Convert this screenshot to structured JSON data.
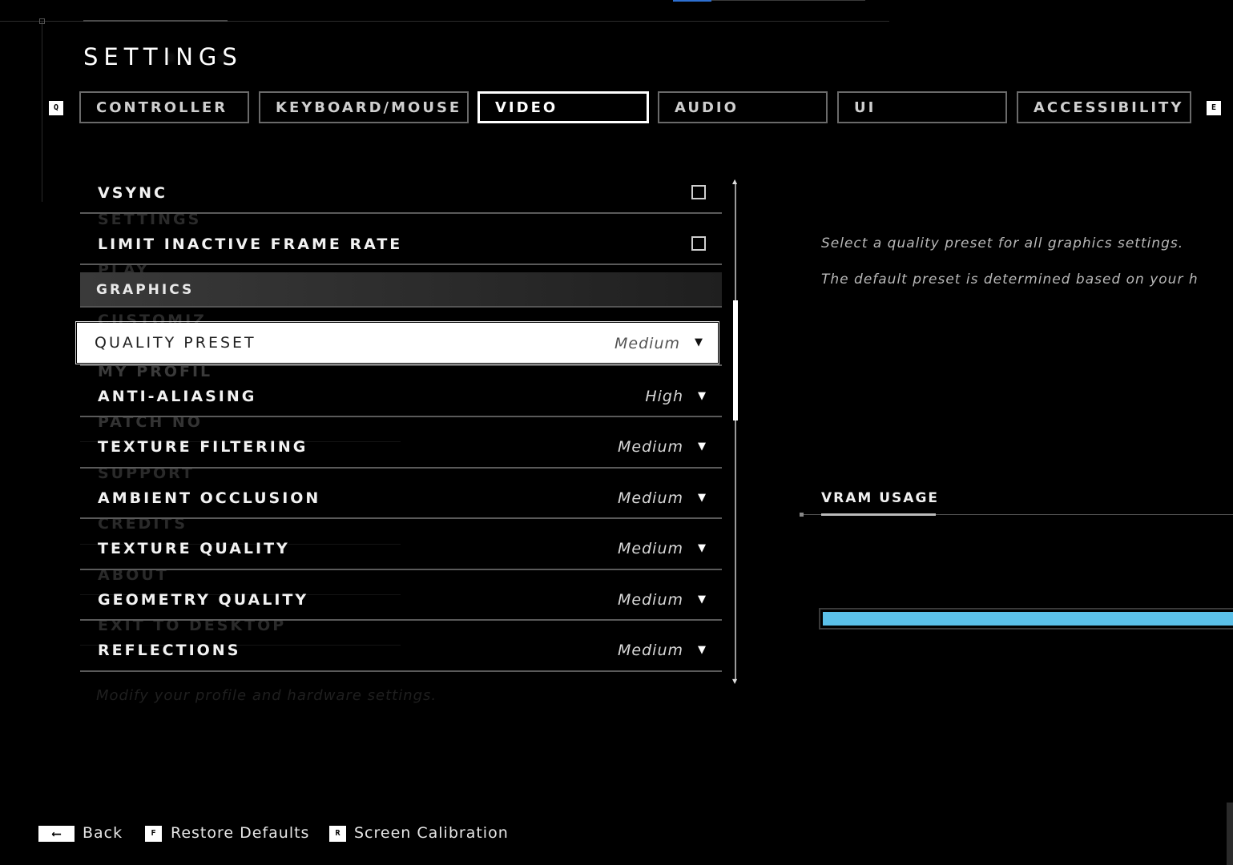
{
  "header": {
    "title": "SETTINGS"
  },
  "tabs": {
    "left_key": "Q",
    "right_key": "E",
    "items": [
      {
        "label": "CONTROLLER"
      },
      {
        "label": "KEYBOARD/MOUSE"
      },
      {
        "label": "VIDEO"
      },
      {
        "label": "AUDIO"
      },
      {
        "label": "UI"
      },
      {
        "label": "ACCESSIBILITY"
      }
    ],
    "active": "VIDEO"
  },
  "settings": {
    "vsync": {
      "label": "VSYNC",
      "checked": false
    },
    "limit_inactive": {
      "label": "LIMIT INACTIVE FRAME RATE",
      "checked": false
    },
    "section_graphics": "GRAPHICS",
    "quality_preset": {
      "label": "QUALITY PRESET",
      "value": "Medium"
    },
    "anti_aliasing": {
      "label": "ANTI-ALIASING",
      "value": "High"
    },
    "texture_filtering": {
      "label": "TEXTURE FILTERING",
      "value": "Medium"
    },
    "ambient_occlusion": {
      "label": "AMBIENT OCCLUSION",
      "value": "Medium"
    },
    "texture_quality": {
      "label": "TEXTURE QUALITY",
      "value": "Medium"
    },
    "geometry_quality": {
      "label": "GEOMETRY QUALITY",
      "value": "Medium"
    },
    "reflections": {
      "label": "REFLECTIONS",
      "value": "Medium"
    }
  },
  "ghost_menu": {
    "items": [
      "SETTINGS",
      "PLAY",
      "CUSTOMIZ",
      "MY PROFIL",
      "PATCH NO",
      "SUPPORT",
      "CREDITS",
      "ABOUT",
      "EXIT TO DESKTOP"
    ],
    "footer": "Modify your profile and hardware settings."
  },
  "description": {
    "line1": "Select a quality preset for all graphics settings.",
    "line2": "The default preset is determined based on your h"
  },
  "vram": {
    "title": "VRAM USAGE",
    "bar_color": "#5bc0e8"
  },
  "footer": {
    "back": {
      "key": "⟵",
      "label": "Back"
    },
    "restore": {
      "key": "F",
      "label": "Restore Defaults"
    },
    "calibration": {
      "key": "R",
      "label": "Screen Calibration"
    }
  }
}
